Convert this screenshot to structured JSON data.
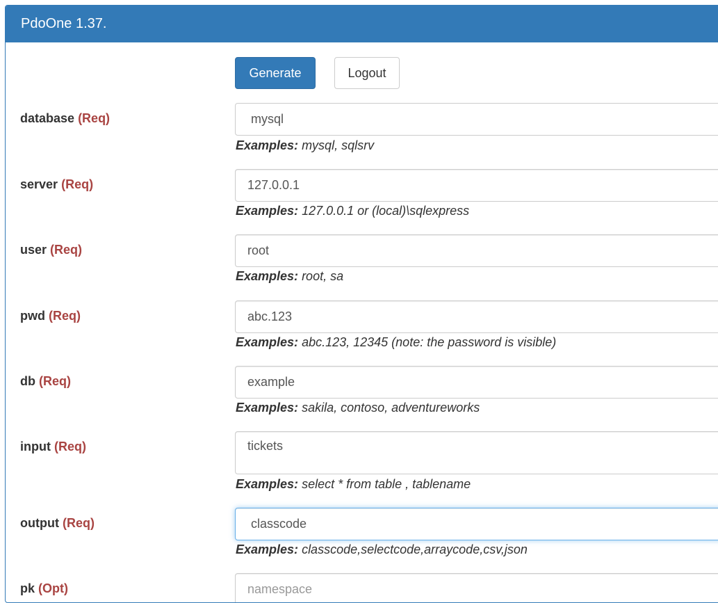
{
  "header": {
    "title": "PdoOne 1.37."
  },
  "buttons": {
    "generate": "Generate",
    "logout": "Logout"
  },
  "required_tag": "(Req)",
  "optional_tag": "(Opt)",
  "examples_label": "Examples:",
  "fields": {
    "database": {
      "label": "database",
      "value": "mysql",
      "examples": "mysql, sqlsrv"
    },
    "server": {
      "label": "server",
      "value": "127.0.0.1",
      "examples": "127.0.0.1 or (local)\\sqlexpress"
    },
    "user": {
      "label": "user",
      "value": "root",
      "examples": "root, sa"
    },
    "pwd": {
      "label": "pwd",
      "value": "abc.123",
      "examples": "abc.123, 12345 (note: the password is visible)"
    },
    "db": {
      "label": "db",
      "value": "example",
      "examples": "sakila, contoso, adventureworks"
    },
    "input": {
      "label": "input",
      "value": "tickets",
      "examples": "select * from table , tablename"
    },
    "output": {
      "label": "output",
      "value": "classcode",
      "examples": "classcode,selectcode,arraycode,csv,json"
    },
    "pk": {
      "label": "pk",
      "placeholder": "namespace"
    }
  }
}
